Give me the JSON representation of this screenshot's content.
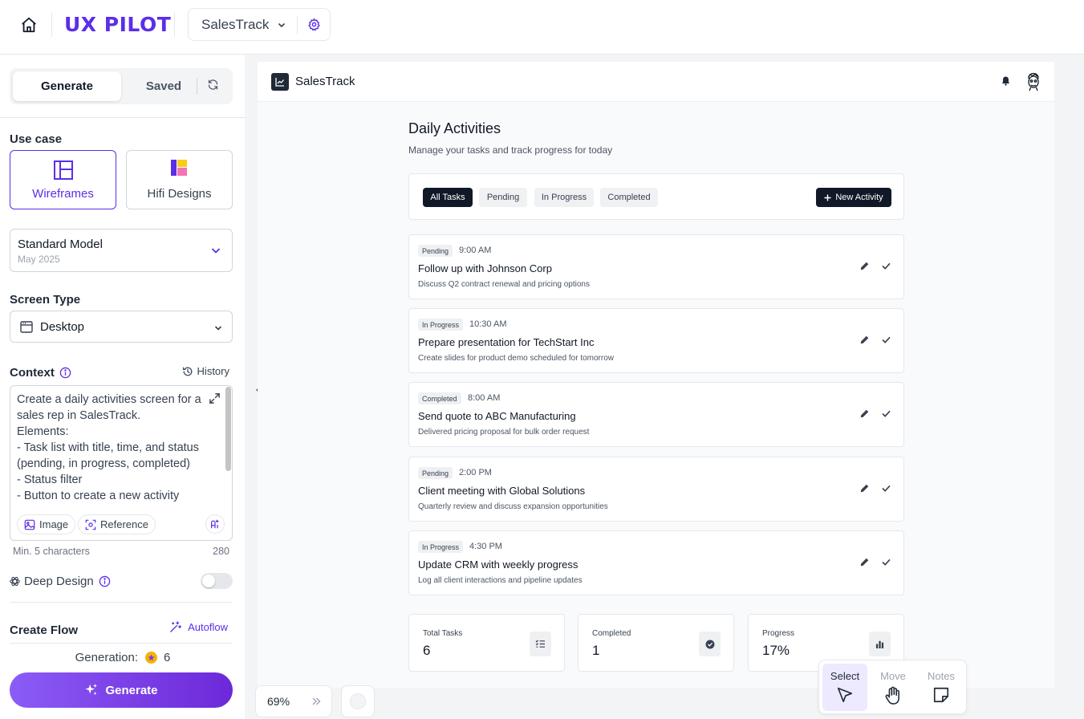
{
  "topbar": {
    "brand": "UX PILOT",
    "project": "SalesTrack"
  },
  "sidebar": {
    "tabs": {
      "generate": "Generate",
      "saved": "Saved"
    },
    "use_case": {
      "label": "Use case",
      "options": [
        {
          "label": "Wireframes",
          "selected": true
        },
        {
          "label": "Hifi Designs",
          "selected": false
        }
      ]
    },
    "model": {
      "name": "Standard Model",
      "date": "May 2025"
    },
    "screen_type": {
      "label": "Screen Type",
      "value": "Desktop"
    },
    "context": {
      "label": "Context",
      "history": "History",
      "text": "Create a daily activities screen for a sales rep in SalesTrack.\nElements:\n- Task list with title, time, and status (pending, in progress, completed)\n- Status filter\n- Button to create a new activity",
      "chips": {
        "image": "Image",
        "reference": "Reference"
      },
      "min_hint": "Min. 5 characters",
      "count": "280"
    },
    "deep_design": {
      "label": "Deep Design",
      "enabled": false
    },
    "create_flow": {
      "label": "Create Flow",
      "autoflow": "Autoflow"
    },
    "generation": {
      "label": "Generation:",
      "count": "6"
    },
    "generate_button": "Generate"
  },
  "app": {
    "name": "SalesTrack",
    "page_title": "Daily Activities",
    "page_subtitle": "Manage your tasks and track progress for today",
    "filters": [
      "All Tasks",
      "Pending",
      "In Progress",
      "Completed"
    ],
    "active_filter": "All Tasks",
    "new_activity": "New Activity",
    "tasks": [
      {
        "status": "Pending",
        "time": "9:00 AM",
        "title": "Follow up with Johnson Corp",
        "description": "Discuss Q2 contract renewal and pricing options"
      },
      {
        "status": "In Progress",
        "time": "10:30 AM",
        "title": "Prepare presentation for TechStart Inc",
        "description": "Create slides for product demo scheduled for tomorrow"
      },
      {
        "status": "Completed",
        "time": "8:00 AM",
        "title": "Send quote to ABC Manufacturing",
        "description": "Delivered pricing proposal for bulk order request"
      },
      {
        "status": "Pending",
        "time": "2:00 PM",
        "title": "Client meeting with Global Solutions",
        "description": "Quarterly review and discuss expansion opportunities"
      },
      {
        "status": "In Progress",
        "time": "4:30 PM",
        "title": "Update CRM with weekly progress",
        "description": "Log all client interactions and pipeline updates"
      }
    ],
    "stats": [
      {
        "label": "Total Tasks",
        "value": "6",
        "icon": "list-check-icon"
      },
      {
        "label": "Completed",
        "value": "1",
        "icon": "check-circle-icon"
      },
      {
        "label": "Progress",
        "value": "17%",
        "icon": "bar-chart-icon"
      }
    ]
  },
  "canvas": {
    "zoom": "69%",
    "tools": [
      {
        "label": "Select",
        "active": true
      },
      {
        "label": "Move",
        "active": false
      },
      {
        "label": "Notes",
        "active": false
      }
    ]
  },
  "colors": {
    "brand": "#5b2ee8",
    "dark": "#111827",
    "generate_gradient_start": "#8b5cf6",
    "generate_gradient_end": "#6d28d9"
  }
}
